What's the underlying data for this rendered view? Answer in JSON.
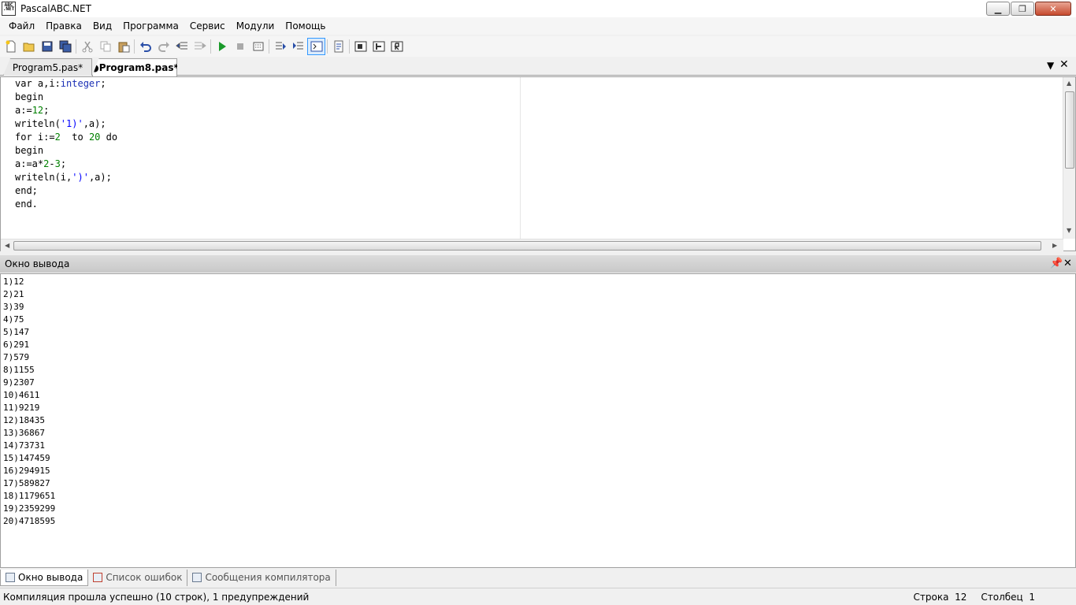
{
  "window": {
    "title": "PascalABC.NET",
    "icon_text": "ABC .NET"
  },
  "menu": [
    "Файл",
    "Правка",
    "Вид",
    "Программа",
    "Сервис",
    "Модули",
    "Помощь"
  ],
  "tabs": [
    {
      "label": "Program5.pas*",
      "active": false
    },
    {
      "label": "●Program8.pas*",
      "active": true
    }
  ],
  "editor": {
    "lines": [
      [
        {
          "t": "var a,i:",
          "c": "kw"
        },
        {
          "t": "integer",
          "c": "ty"
        },
        {
          "t": ";",
          "c": "kw"
        }
      ],
      [
        {
          "t": "begin",
          "c": "kw"
        }
      ],
      [
        {
          "t": "a:=",
          "c": "kw"
        },
        {
          "t": "12",
          "c": "num"
        },
        {
          "t": ";",
          "c": "kw"
        }
      ],
      [
        {
          "t": "writeln(",
          "c": "kw"
        },
        {
          "t": "'1)'",
          "c": "str"
        },
        {
          "t": ",a);",
          "c": "kw"
        }
      ],
      [
        {
          "t": "for i:=",
          "c": "kw"
        },
        {
          "t": "2",
          "c": "num"
        },
        {
          "t": "  to ",
          "c": "kw"
        },
        {
          "t": "20",
          "c": "num"
        },
        {
          "t": " do",
          "c": "kw"
        }
      ],
      [
        {
          "t": "begin",
          "c": "kw"
        }
      ],
      [
        {
          "t": "a:=a*",
          "c": "kw"
        },
        {
          "t": "2",
          "c": "num"
        },
        {
          "t": "-",
          "c": "kw"
        },
        {
          "t": "3",
          "c": "num"
        },
        {
          "t": ";",
          "c": "kw"
        }
      ],
      [
        {
          "t": "writeln(i,",
          "c": "kw"
        },
        {
          "t": "')'",
          "c": "str"
        },
        {
          "t": ",a);",
          "c": "kw"
        }
      ],
      [
        {
          "t": "end;",
          "c": "kw"
        }
      ],
      [
        {
          "t": "end.",
          "c": "kw"
        }
      ]
    ]
  },
  "output_panel": {
    "title": "Окно вывода",
    "lines": [
      "1)12",
      "2)21",
      "3)39",
      "4)75",
      "5)147",
      "6)291",
      "7)579",
      "8)1155",
      "9)2307",
      "10)4611",
      "11)9219",
      "12)18435",
      "13)36867",
      "14)73731",
      "15)147459",
      "16)294915",
      "17)589827",
      "18)1179651",
      "19)2359299",
      "20)4718595"
    ]
  },
  "bottom_tabs": [
    "Окно вывода",
    "Список ошибок",
    "Сообщения компилятора"
  ],
  "status": {
    "message": "Компиляция прошла успешно (10 строк), 1 предупреждений",
    "row_label": "Строка",
    "row_value": "12",
    "col_label": "Столбец",
    "col_value": "1"
  },
  "toolbar_icons": [
    "new-file-icon",
    "open-icon",
    "save-icon",
    "save-all-icon",
    "cut-icon",
    "copy-icon",
    "paste-icon",
    "undo-icon",
    "redo-icon",
    "unindent-icon",
    "indent-icon",
    "run-icon",
    "stop-icon",
    "compile-icon",
    "step-into-icon",
    "step-over-icon",
    "output-window-icon",
    "format-icon",
    "module-icon",
    "debug-icon",
    "reference-icon"
  ]
}
